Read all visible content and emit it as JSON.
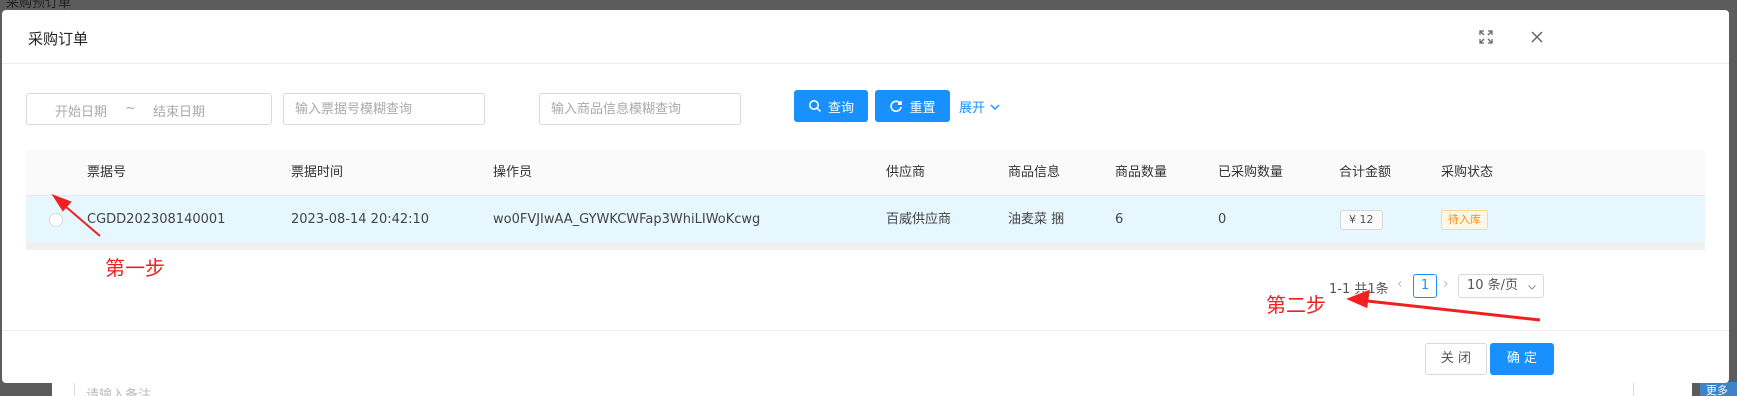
{
  "backdrop": {
    "title": "采购预订单",
    "remark_placeholder": "请输入备注",
    "right_button": "更多"
  },
  "dialog": {
    "title": "采购订单",
    "icons": {
      "fullscreen": "fullscreen-icon",
      "close": "close-icon"
    }
  },
  "filters": {
    "start_date_placeholder": "开始日期",
    "separator": "~",
    "end_date_placeholder": "结束日期",
    "bill_placeholder": "输入票据号模糊查询",
    "goods_placeholder": "输入商品信息模糊查询",
    "search_label": "查询",
    "reset_label": "重置",
    "expand_label": "展开"
  },
  "table": {
    "columns": [
      "票据号",
      "票据时间",
      "操作员",
      "供应商",
      "商品信息",
      "商品数量",
      "已采购数量",
      "合计金额",
      "采购状态"
    ],
    "rows": [
      {
        "bill_no": "CGDD202308140001",
        "bill_time": "2023-08-14 20:42:10",
        "operator": "wo0FVJIwAA_GYWKCWFap3WhiLIWoKcwg",
        "supplier": "百威供应商",
        "goods": "油麦菜 捆",
        "qty": "6",
        "purchased_qty": "0",
        "amount": "¥ 12",
        "status": "待入库"
      }
    ]
  },
  "pagination": {
    "total": "1-1 共1条",
    "current": "1",
    "page_size": "10 条/页"
  },
  "footer": {
    "close_label": "关 闭",
    "ok_label": "确 定"
  },
  "annotations": {
    "step1": "第一步",
    "step2": "第二步"
  },
  "colors": {
    "primary": "#1890ff",
    "annotation": "#f02020",
    "selected_row": "#e6f7ff",
    "status_tag": "#fa8c16"
  }
}
